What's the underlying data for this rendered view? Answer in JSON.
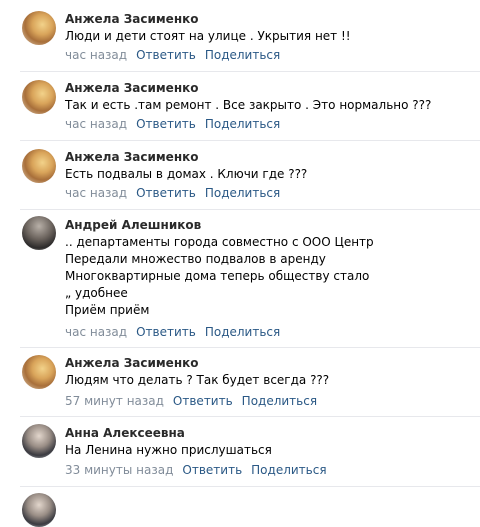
{
  "comments": [
    {
      "author": "Анжела Засименко",
      "lines": [
        "Люди и дети стоят на улице . Укрытия нет !!"
      ],
      "time": "час назад",
      "reply": "Ответить",
      "share": "Поделиться"
    },
    {
      "author": "Анжела Засименко",
      "lines": [
        "Так и есть .там ремонт . Все закрыто . Это нормально ???"
      ],
      "time": "час назад",
      "reply": "Ответить",
      "share": "Поделиться"
    },
    {
      "author": "Анжела Засименко",
      "lines": [
        "Есть подвалы в домах . Ключи где ???"
      ],
      "time": "час назад",
      "reply": "Ответить",
      "share": "Поделиться"
    },
    {
      "author": "Андрей Алешников",
      "lines": [
        ".. департаменты города совместно с ООО Центр",
        "Передали множество подвалов в аренду",
        "Многоквартирные дома теперь обществу стало",
        "„ удобнее",
        "Приём приём"
      ],
      "time": "час назад",
      "reply": "Ответить",
      "share": "Поделиться"
    },
    {
      "author": "Анжела Засименко",
      "lines": [
        "Людям что делать ? Так будет всегда ???"
      ],
      "time": "57 минут назад",
      "reply": "Ответить",
      "share": "Поделиться"
    },
    {
      "author": "Анна Алексеевна",
      "lines": [
        "На Ленина нужно прислушаться"
      ],
      "time": "33 минуты назад",
      "reply": "Ответить",
      "share": "Поделиться"
    }
  ]
}
